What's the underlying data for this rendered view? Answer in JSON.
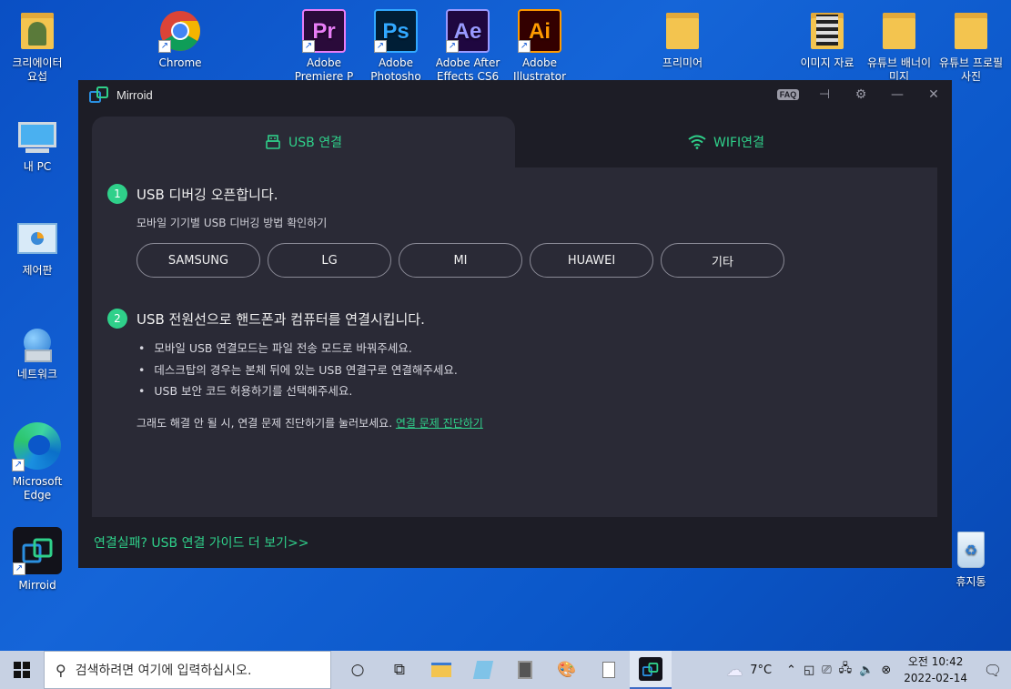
{
  "desktop": {
    "icons": [
      {
        "label": "크리에이터\n요섭",
        "name": "user-folder-icon"
      },
      {
        "label": "Chrome",
        "name": "chrome-icon"
      },
      {
        "label": "Adobe Premiere P",
        "name": "premiere-icon"
      },
      {
        "label": "Adobe Photosho",
        "name": "photoshop-icon"
      },
      {
        "label": "Adobe After Effects CS6",
        "name": "after-effects-icon"
      },
      {
        "label": "Adobe Illustrator",
        "name": "illustrator-icon"
      },
      {
        "label": "프리미어",
        "name": "folder-icon"
      },
      {
        "label": "이미지 자료",
        "name": "image-folder-icon"
      },
      {
        "label": "유튜브 배너이미지",
        "name": "folder-icon"
      },
      {
        "label": "유튜브 프로필사진",
        "name": "folder-icon"
      },
      {
        "label": "내 PC",
        "name": "pc-icon"
      },
      {
        "label": "제어판",
        "name": "control-panel-icon"
      },
      {
        "label": "네트워크",
        "name": "network-icon"
      },
      {
        "label": "Microsoft Edge",
        "name": "edge-icon"
      },
      {
        "label": "Mirroid",
        "name": "mirroid-icon"
      },
      {
        "label": "휴지통",
        "name": "recycle-bin-icon"
      }
    ],
    "adobe_codes": {
      "pr": "Pr",
      "ps": "Ps",
      "ae": "Ae",
      "ai": "Ai"
    }
  },
  "window": {
    "title": "Mirroid",
    "faq_label": "FAQ",
    "tabs": [
      {
        "label": "USB 연결",
        "icon": "usb-icon"
      },
      {
        "label": "WIFI연결",
        "icon": "wifi-icon"
      }
    ],
    "step1": {
      "num": "1",
      "title": "USB 디버깅 오픈합니다.",
      "subtitle": "모바일 기기별 USB 디버깅 방법 확인하기",
      "brands": [
        "SAMSUNG",
        "LG",
        "MI",
        "HUAWEI",
        "기타"
      ]
    },
    "step2": {
      "num": "2",
      "title": "USB 전원선으로 핸드폰과 컴퓨터를 연결시킵니다.",
      "bullets": [
        "모바일 USB 연결모드는 파일 전송 모드로 바꿔주세요.",
        "데스크탑의 경우는 본체 뒤에 있는 USB 연결구로 연결해주세요.",
        "USB 보안 코드 허용하기를 선택해주세요."
      ],
      "help_text": "그래도 해결 안 될 시, 연결 문제 진단하기를 눌러보세요.",
      "help_link": "연결 문제 진단하기"
    },
    "guide_link": "연결실패? USB 연결 가이드 더 보기>>"
  },
  "taskbar": {
    "search_placeholder": "검색하려면 여기에 입력하십시오.",
    "weather": "7°C",
    "time": "오전 10:42",
    "date": "2022-02-14"
  },
  "colors": {
    "accent": "#2fd08a",
    "window_bg": "#1d1d26",
    "panel_bg": "#2a2a36"
  }
}
